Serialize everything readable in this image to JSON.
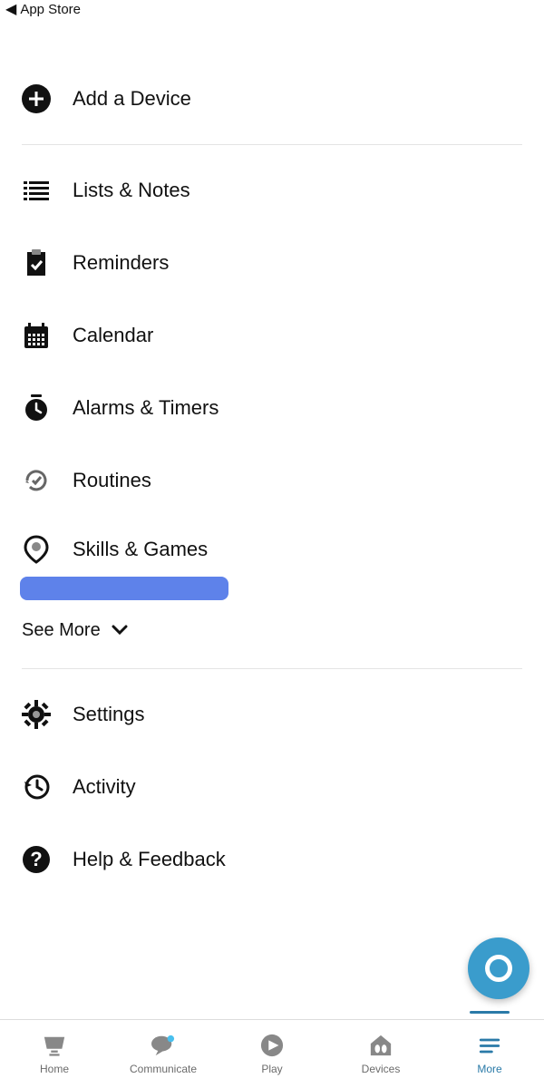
{
  "back_label": "App Store",
  "sections": {
    "device": {
      "add_device": "Add a Device"
    },
    "features": [
      {
        "label": "Lists & Notes"
      },
      {
        "label": "Reminders"
      },
      {
        "label": "Calendar"
      },
      {
        "label": "Alarms & Timers"
      },
      {
        "label": "Routines"
      },
      {
        "label": "Skills & Games"
      }
    ],
    "see_more": "See More",
    "system": [
      {
        "label": "Settings"
      },
      {
        "label": "Activity"
      },
      {
        "label": "Help & Feedback"
      }
    ]
  },
  "tabs": [
    {
      "label": "Home"
    },
    {
      "label": "Communicate"
    },
    {
      "label": "Play"
    },
    {
      "label": "Devices"
    },
    {
      "label": "More"
    }
  ]
}
